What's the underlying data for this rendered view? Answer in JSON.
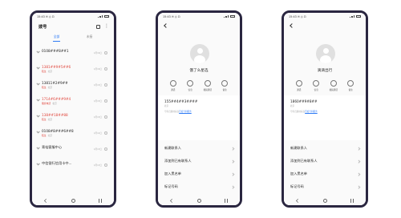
{
  "phone1": {
    "status_time": "15:43 ✉ ◎ ⊡",
    "title": "拨号",
    "tabs": [
      {
        "label": "全部",
        "active": true
      },
      {
        "label": "未接",
        "active": false
      }
    ],
    "calls": [
      {
        "number": "0108###8##1",
        "missed": false,
        "sub": "",
        "location": "",
        "time": "4月16日"
      },
      {
        "number": "1381##9#5##6",
        "missed": true,
        "sub": "陌生",
        "location": "北京",
        "time": "4月16日"
      },
      {
        "number": "13811#2#9##",
        "missed": false,
        "sub": "陌生",
        "location": "北京",
        "time": "4月15日"
      },
      {
        "number": "1714#6###9#4",
        "missed": true,
        "sub": "骚扰电话",
        "location": "北京",
        "time": "4月15日"
      },
      {
        "number": "138##18##88",
        "missed": true,
        "sub": "陌生",
        "location": "北京",
        "time": "4月15日"
      },
      {
        "number": "0108#8###6##8",
        "missed": false,
        "sub": "陌生",
        "location": "北京",
        "time": "4月14日"
      },
      {
        "number": "青桔客服中心",
        "missed": false,
        "sub": "",
        "location": "",
        "time": "4月13日"
      },
      {
        "number": "中信银行信用卡中...",
        "missed": false,
        "sub": "",
        "location": "",
        "time": "4月13日"
      }
    ]
  },
  "phone2": {
    "status_time": "15:43 ✉ ◎ ⊡",
    "name": "饿了么星选",
    "actions": [
      "通话",
      "信息",
      "视频通话",
      "备注"
    ],
    "phone_number": "155##4##3####",
    "location": "北京",
    "loc_prefix": "号码归属地来自",
    "loc_link": "百度号码服务",
    "menu": [
      "新建联系人",
      "添加到已有联系人",
      "加入黑名单",
      "标记号码",
      "数据纠错"
    ]
  },
  "phone3": {
    "status_time": "15:43 ✉ ◎ ⊡",
    "name": "滴滴出行",
    "actions": [
      "通话",
      "信息",
      "视频通话",
      "备注"
    ],
    "phone_number": "1860##9#8##",
    "location": "北京",
    "loc_prefix": "号码归属地来自",
    "loc_link": "百度号码服务",
    "menu": [
      "新建联系人",
      "添加到已有联系人",
      "加入黑名单",
      "标记号码",
      "数据纠错"
    ]
  }
}
